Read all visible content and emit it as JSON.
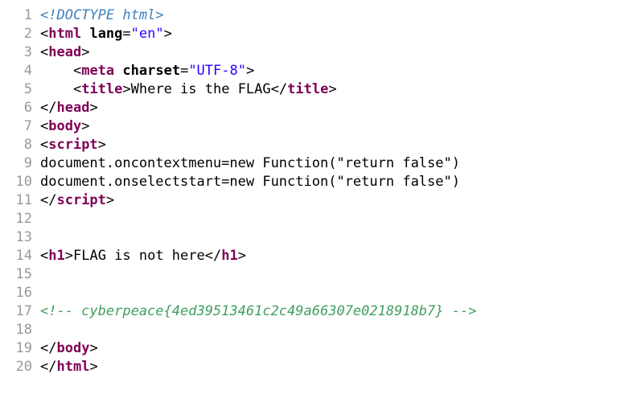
{
  "lines": [
    {
      "n": "1",
      "parts": [
        {
          "c": "t-doctype",
          "t": "<!DOCTYPE html>"
        }
      ]
    },
    {
      "n": "2",
      "parts": [
        {
          "c": "t-punct",
          "t": "<"
        },
        {
          "c": "t-tag",
          "t": "html"
        },
        {
          "c": "t-text",
          "t": " "
        },
        {
          "c": "t-attr",
          "t": "lang"
        },
        {
          "c": "t-punct",
          "t": "="
        },
        {
          "c": "t-value",
          "t": "\"en\""
        },
        {
          "c": "t-punct",
          "t": ">"
        }
      ]
    },
    {
      "n": "3",
      "parts": [
        {
          "c": "t-punct",
          "t": "<"
        },
        {
          "c": "t-tag",
          "t": "head"
        },
        {
          "c": "t-punct",
          "t": ">"
        }
      ]
    },
    {
      "n": "4",
      "parts": [
        {
          "c": "t-text",
          "t": "    "
        },
        {
          "c": "t-punct",
          "t": "<"
        },
        {
          "c": "t-tag",
          "t": "meta"
        },
        {
          "c": "t-text",
          "t": " "
        },
        {
          "c": "t-attr",
          "t": "charset"
        },
        {
          "c": "t-punct",
          "t": "="
        },
        {
          "c": "t-value",
          "t": "\"UTF-8\""
        },
        {
          "c": "t-punct",
          "t": ">"
        }
      ]
    },
    {
      "n": "5",
      "parts": [
        {
          "c": "t-text",
          "t": "    "
        },
        {
          "c": "t-punct",
          "t": "<"
        },
        {
          "c": "t-tag",
          "t": "title"
        },
        {
          "c": "t-punct",
          "t": ">"
        },
        {
          "c": "t-text",
          "t": "Where is the FLAG"
        },
        {
          "c": "t-punct",
          "t": "</"
        },
        {
          "c": "t-tag",
          "t": "title"
        },
        {
          "c": "t-punct",
          "t": ">"
        }
      ]
    },
    {
      "n": "6",
      "parts": [
        {
          "c": "t-punct",
          "t": "</"
        },
        {
          "c": "t-tag",
          "t": "head"
        },
        {
          "c": "t-punct",
          "t": ">"
        }
      ]
    },
    {
      "n": "7",
      "parts": [
        {
          "c": "t-punct",
          "t": "<"
        },
        {
          "c": "t-tag",
          "t": "body"
        },
        {
          "c": "t-punct",
          "t": ">"
        }
      ]
    },
    {
      "n": "8",
      "parts": [
        {
          "c": "t-punct",
          "t": "<"
        },
        {
          "c": "t-tag",
          "t": "script"
        },
        {
          "c": "t-punct",
          "t": ">"
        }
      ]
    },
    {
      "n": "9",
      "parts": [
        {
          "c": "t-text",
          "t": "document.oncontextmenu=new Function(\"return false\")"
        }
      ]
    },
    {
      "n": "10",
      "parts": [
        {
          "c": "t-text",
          "t": "document.onselectstart=new Function(\"return false\")"
        }
      ]
    },
    {
      "n": "11",
      "parts": [
        {
          "c": "t-punct",
          "t": "</"
        },
        {
          "c": "t-tag",
          "t": "script"
        },
        {
          "c": "t-punct",
          "t": ">"
        }
      ]
    },
    {
      "n": "12",
      "parts": []
    },
    {
      "n": "13",
      "parts": []
    },
    {
      "n": "14",
      "parts": [
        {
          "c": "t-punct",
          "t": "<"
        },
        {
          "c": "t-tag",
          "t": "h1"
        },
        {
          "c": "t-punct",
          "t": ">"
        },
        {
          "c": "t-text",
          "t": "FLAG is not here"
        },
        {
          "c": "t-punct",
          "t": "</"
        },
        {
          "c": "t-tag",
          "t": "h1"
        },
        {
          "c": "t-punct",
          "t": ">"
        }
      ]
    },
    {
      "n": "15",
      "parts": []
    },
    {
      "n": "16",
      "parts": []
    },
    {
      "n": "17",
      "parts": [
        {
          "c": "t-comment",
          "t": "<!-- cyberpeace{4ed39513461c2c49a66307e0218918b7} -->"
        }
      ]
    },
    {
      "n": "18",
      "parts": []
    },
    {
      "n": "19",
      "parts": [
        {
          "c": "t-punct",
          "t": "</"
        },
        {
          "c": "t-tag",
          "t": "body"
        },
        {
          "c": "t-punct",
          "t": ">"
        }
      ]
    },
    {
      "n": "20",
      "parts": [
        {
          "c": "t-punct",
          "t": "</"
        },
        {
          "c": "t-tag",
          "t": "html"
        },
        {
          "c": "t-punct",
          "t": ">"
        }
      ]
    }
  ]
}
